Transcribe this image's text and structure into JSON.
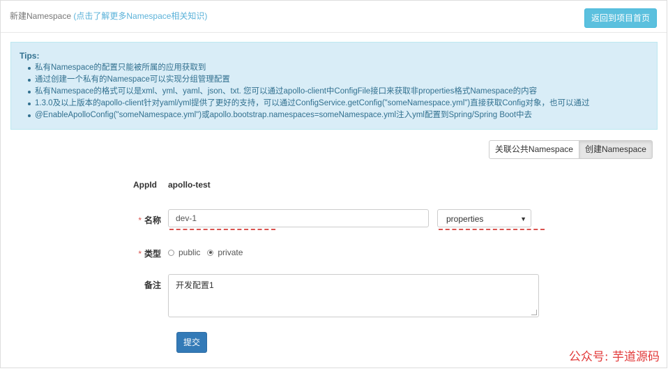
{
  "header": {
    "title": "新建Namespace",
    "link_text": "(点击了解更多Namespace相关知识)",
    "back_button": "返回到项目首页"
  },
  "tips": {
    "title": "Tips:",
    "items": [
      "私有Namespace的配置只能被所属的应用获取到",
      "通过创建一个私有的Namespace可以实现分组管理配置",
      "私有Namespace的格式可以是xml、yml、yaml、json、txt. 您可以通过apollo-client中ConfigFile接口来获取非properties格式Namespace的内容",
      "1.3.0及以上版本的apollo-client针对yaml/yml提供了更好的支持，可以通过ConfigService.getConfig(\"someNamespace.yml\")直接获取Config对象，也可以通过",
      "@EnableApolloConfig(\"someNamespace.yml\")或apollo.bootstrap.namespaces=someNamespace.yml注入yml配置到Spring/Spring Boot中去"
    ]
  },
  "tabs": {
    "associate": "关联公共Namespace",
    "create": "创建Namespace"
  },
  "form": {
    "appid_label": "AppId",
    "appid_value": "apollo-test",
    "required_mark": "*",
    "name_label": "名称",
    "name_value": "dev-1",
    "format_value": "properties",
    "type_label": "类型",
    "type_options": [
      "public",
      "private"
    ],
    "type_selected": "private",
    "comment_label": "备注",
    "comment_value": "开发配置1",
    "submit_label": "提交"
  },
  "watermark": "公众号: 芋道源码",
  "colors": {
    "info_bg": "#d9edf7",
    "info_text": "#31708f",
    "primary": "#337ab7",
    "info_button": "#5bc0de",
    "required": "#d9534f"
  }
}
